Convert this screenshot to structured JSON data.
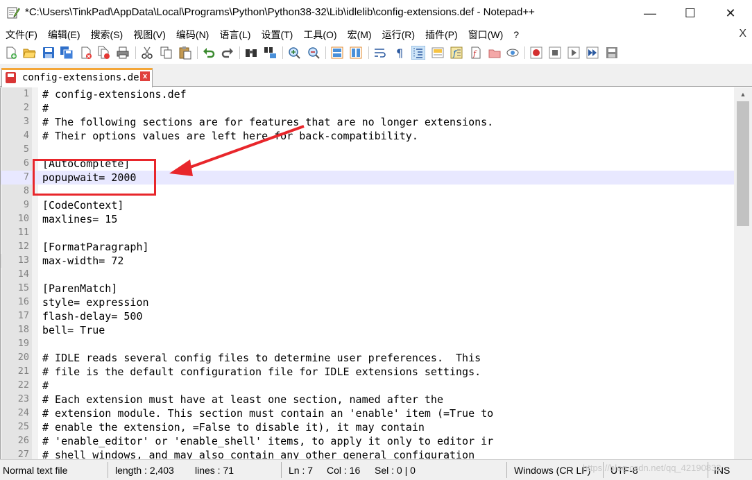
{
  "window": {
    "title": "*C:\\Users\\TinkPad\\AppData\\Local\\Programs\\Python\\Python38-32\\Lib\\idlelib\\config-extensions.def - Notepad++",
    "minimize_glyph": "—",
    "maximize_glyph": "☐",
    "close_glyph": "✕"
  },
  "menu": {
    "items": [
      "文件(F)",
      "编辑(E)",
      "搜索(S)",
      "视图(V)",
      "编码(N)",
      "语言(L)",
      "设置(T)",
      "工具(O)",
      "宏(M)",
      "运行(R)",
      "插件(P)",
      "窗口(W)",
      "?"
    ],
    "close_glyph": "X"
  },
  "toolbar": {
    "icons": [
      "new-file-icon",
      "open-file-icon",
      "save-icon",
      "save-all-icon",
      "close-icon",
      "close-all-icon",
      "print-icon",
      "cut-icon",
      "copy-icon",
      "paste-icon",
      "undo-icon",
      "redo-icon",
      "find-icon",
      "replace-icon",
      "zoom-in-icon",
      "zoom-out-icon",
      "sync-vertical-icon",
      "sync-horizontal-icon",
      "word-wrap-icon",
      "show-all-chars-icon",
      "indent-guide-icon",
      "doc-map-icon",
      "function-list-icon",
      "folder-workspace-icon",
      "monitor-icon",
      "record-macro-icon",
      "stop-macro-icon",
      "play-macro-icon",
      "run-macro-multiple-icon",
      "save-macro-icon"
    ]
  },
  "tab": {
    "label": "config-extensions.def",
    "close_glyph": "x"
  },
  "editor": {
    "current_line": 7,
    "lines": [
      "# config-extensions.def",
      "#",
      "# The following sections are for features that are no longer extensions.",
      "# Their options values are left here for back-compatibility.",
      "",
      "[AutoComplete]",
      "popupwait= 2000",
      "",
      "[CodeContext]",
      "maxlines= 15",
      "",
      "[FormatParagraph]",
      "max-width= 72",
      "",
      "[ParenMatch]",
      "style= expression",
      "flash-delay= 500",
      "bell= True",
      "",
      "# IDLE reads several config files to determine user preferences.  This",
      "# file is the default configuration file for IDLE extensions settings.",
      "#",
      "# Each extension must have at least one section, named after the",
      "# extension module. This section must contain an 'enable' item (=True to",
      "# enable the extension, =False to disable it), it may contain",
      "# 'enable_editor' or 'enable_shell' items, to apply it only to editor ir",
      "# shell windows, and may also contain any other general configuration"
    ]
  },
  "statusbar": {
    "file_type": "Normal text file",
    "length": "length : 2,403",
    "lines": "lines : 71",
    "ln": "Ln : 7",
    "col": "Col : 16",
    "sel": "Sel : 0 | 0",
    "eol": "Windows (CR LF)",
    "encoding": "UTF-8",
    "mode": "INS"
  },
  "watermark": "https://blog.csdn.net/qq_42190832",
  "colors": {
    "annotation_red": "#e8262b",
    "current_line_bg": "#e8e8ff",
    "tab_accent": "#f4a638"
  }
}
